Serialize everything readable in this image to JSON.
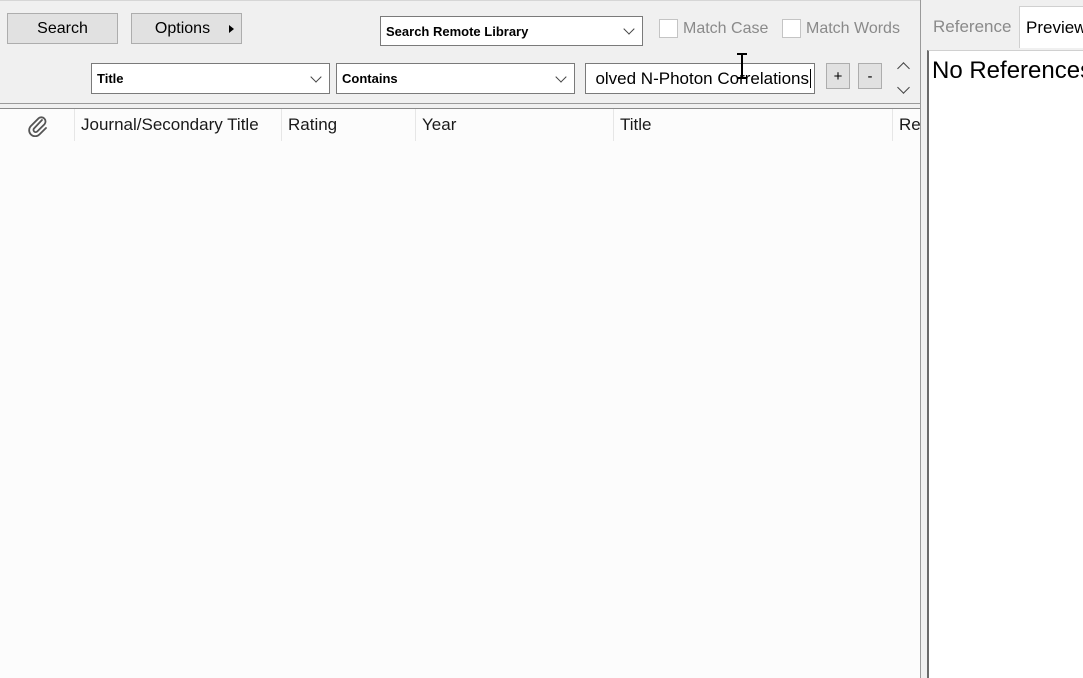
{
  "search": {
    "search_button": "Search",
    "options_button": "Options",
    "library_select": "Search Remote Library",
    "match_case": "Match Case",
    "match_words": "Match Words",
    "field_select": "Title",
    "operator_select": "Contains",
    "query_value": "olved N-Photon Correlations",
    "plus_button": "+",
    "minus_button": "-"
  },
  "table": {
    "columns": [
      "Journal/Secondary Title",
      "Rating",
      "Year",
      "Title",
      "Re"
    ]
  },
  "right_pane": {
    "tabs": [
      "Reference",
      "Preview"
    ],
    "empty_message": "No References"
  },
  "icons": {
    "attachment": "paperclip-icon",
    "cursor": "text-cursor-icon"
  }
}
